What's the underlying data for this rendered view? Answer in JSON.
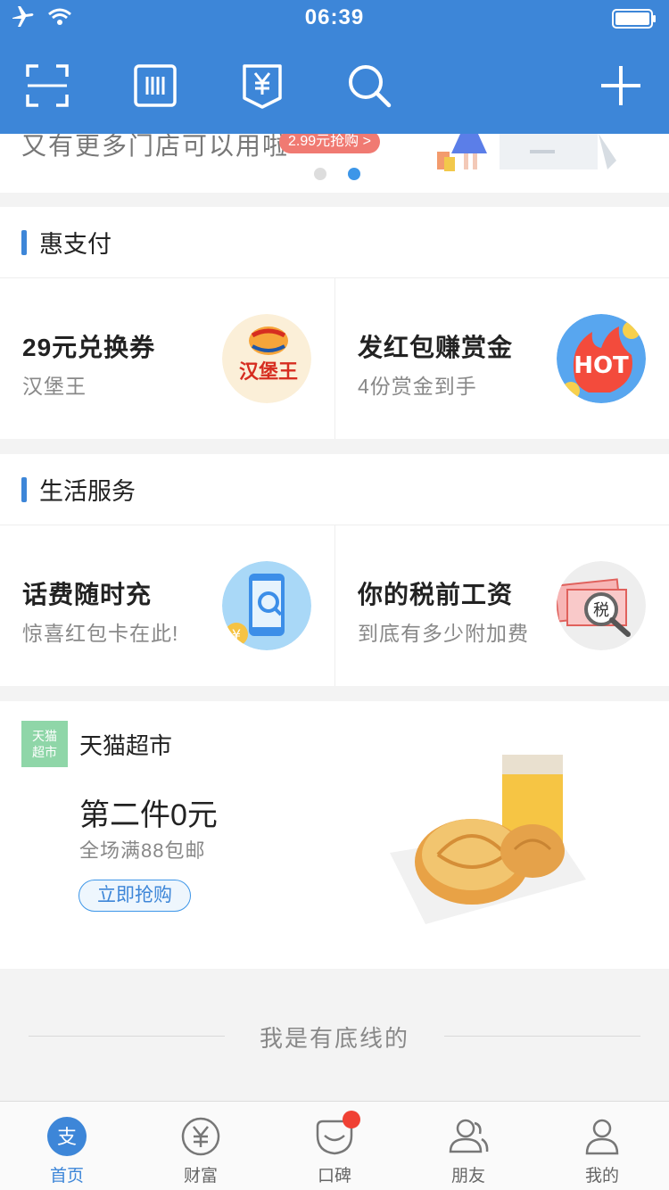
{
  "status": {
    "time": "06:39"
  },
  "banner": {
    "text": "又有更多门店可以用啦",
    "badge": "2.99元抢购 >",
    "dots": 2,
    "active_dot": 1
  },
  "sections": [
    {
      "title": "惠支付",
      "cards": [
        {
          "title": "29元兑换券",
          "subtitle": "汉堡王",
          "icon": "burger-king-logo",
          "logo_text": "汉堡王"
        },
        {
          "title": "发红包赚赏金",
          "subtitle": "4份赏金到手",
          "icon": "hot-fire-icon",
          "logo_text": "HOT"
        }
      ]
    },
    {
      "title": "生活服务",
      "cards": [
        {
          "title": "话费随时充",
          "subtitle": "惊喜红包卡在此!",
          "icon": "phone-search-icon"
        },
        {
          "title": "你的税前工资",
          "subtitle": "到底有多少附加费",
          "icon": "tax-magnifier-icon",
          "logo_text": "税"
        }
      ]
    }
  ],
  "tmall": {
    "logo_line1": "天猫",
    "logo_line2": "超市",
    "name": "天猫超市",
    "title": "第二件0元",
    "subtitle": "全场满88包邮",
    "button": "立即抢购"
  },
  "footer_text": "我是有底线的",
  "tabs": [
    {
      "label": "首页",
      "icon": "alipay-icon",
      "active": true
    },
    {
      "label": "财富",
      "icon": "yen-circle-icon"
    },
    {
      "label": "口碑",
      "icon": "koubei-icon",
      "badge": true
    },
    {
      "label": "朋友",
      "icon": "friends-icon"
    },
    {
      "label": "我的",
      "icon": "profile-icon"
    }
  ],
  "colors": {
    "primary": "#3d86d8",
    "accent_red": "#f04134",
    "tmall_green": "#8fd6a8"
  }
}
